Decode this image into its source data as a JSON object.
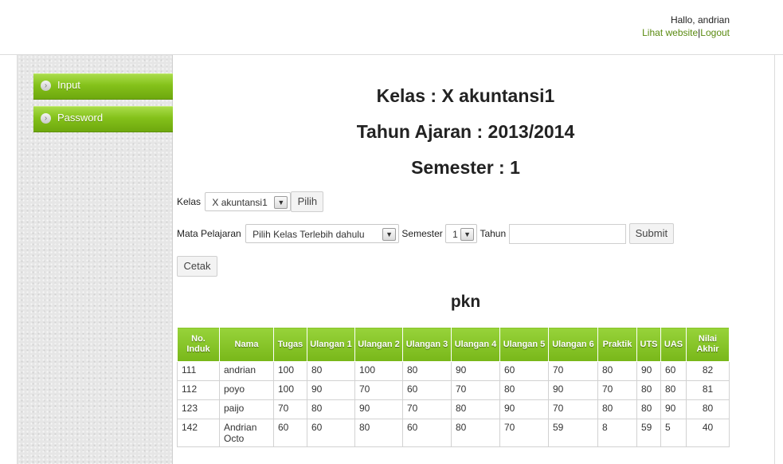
{
  "header": {
    "greeting": "Hallo, andrian",
    "view_site": "Lihat website",
    "separator": "|",
    "logout": "Logout"
  },
  "sidebar": {
    "items": [
      {
        "label": "Input",
        "icon": "chevron-right-icon"
      },
      {
        "label": "Password",
        "icon": "chevron-right-icon"
      }
    ]
  },
  "main": {
    "heading_class": "Kelas : X akuntansi1",
    "heading_year": "Tahun Ajaran : 2013/2014",
    "heading_semester": "Semester : 1",
    "kelas_label": "Kelas",
    "kelas_value": "X akuntansi1",
    "pilih_button": "Pilih",
    "mapel_label": "Mata Pelajaran",
    "mapel_value": "Pilih Kelas Terlebih dahulu",
    "semester_label": "Semester",
    "semester_value": "1",
    "tahun_label": "Tahun",
    "tahun_value": "",
    "submit_button": "Submit",
    "cetak_button": "Cetak",
    "table_title": "pkn"
  },
  "table": {
    "headers": [
      "No. Induk",
      "Nama",
      "Tugas",
      "Ulangan 1",
      "Ulangan 2",
      "Ulangan 3",
      "Ulangan 4",
      "Ulangan 5",
      "Ulangan 6",
      "Praktik",
      "UTS",
      "UAS",
      "Nilai Akhir"
    ],
    "rows": [
      [
        "111",
        "andrian",
        "100",
        "80",
        "100",
        "80",
        "90",
        "60",
        "70",
        "80",
        "90",
        "60",
        "82"
      ],
      [
        "112",
        "poyo",
        "100",
        "90",
        "70",
        "60",
        "70",
        "80",
        "90",
        "70",
        "80",
        "80",
        "81"
      ],
      [
        "123",
        "paijo",
        "70",
        "80",
        "90",
        "70",
        "80",
        "90",
        "70",
        "80",
        "80",
        "90",
        "80"
      ],
      [
        "142",
        "Andrian Octo",
        "60",
        "60",
        "80",
        "60",
        "80",
        "70",
        "59",
        "8",
        "59",
        "5",
        "40"
      ]
    ]
  },
  "colors": {
    "accent_green": "#84c11a",
    "link_green": "#5a8a10"
  }
}
